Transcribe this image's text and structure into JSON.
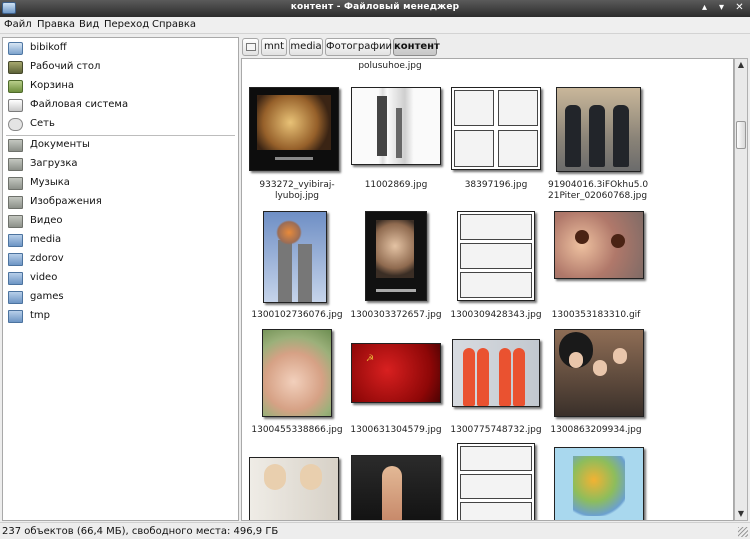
{
  "window": {
    "title": "контент - Файловый менеджер"
  },
  "menubar": {
    "items": [
      "Файл",
      "Правка",
      "Вид",
      "Переход",
      "Справка"
    ]
  },
  "sidebar": {
    "places": [
      {
        "label": "bibikoff",
        "icon": "home-folder-icon"
      },
      {
        "label": "Рабочий стол",
        "icon": "desktop-icon"
      },
      {
        "label": "Корзина",
        "icon": "trash-icon"
      },
      {
        "label": "Файловая система",
        "icon": "drive-icon"
      },
      {
        "label": "Сеть",
        "icon": "network-icon"
      }
    ],
    "bookmarks": [
      {
        "label": "Документы",
        "icon": "folder-icon"
      },
      {
        "label": "Загрузка",
        "icon": "folder-icon"
      },
      {
        "label": "Музыка",
        "icon": "folder-icon"
      },
      {
        "label": "Изображения",
        "icon": "folder-icon"
      },
      {
        "label": "Видео",
        "icon": "folder-icon"
      },
      {
        "label": "media",
        "icon": "folder-icon"
      },
      {
        "label": "zdorov",
        "icon": "folder-icon"
      },
      {
        "label": "video",
        "icon": "folder-icon"
      },
      {
        "label": "games",
        "icon": "folder-icon"
      },
      {
        "label": "tmp",
        "icon": "folder-icon"
      }
    ]
  },
  "pathbar": {
    "crumbs": [
      "mnt",
      "media",
      "Фотографии",
      "контент"
    ],
    "active": "контент"
  },
  "content": {
    "partial_label": "polusuhoe.jpg",
    "files": [
      {
        "name1": "933272_vyibiraj-",
        "name2": "lyuboj.jpg"
      },
      {
        "name1": "11002869.jpg",
        "name2": ""
      },
      {
        "name1": "38397196.jpg",
        "name2": ""
      },
      {
        "name1": "91904016.3iFOkhu5.0",
        "name2": "21Piter_02060768.jpg"
      },
      {
        "name1": "1300102736076.jpg",
        "name2": ""
      },
      {
        "name1": "1300303372657.jpg",
        "name2": ""
      },
      {
        "name1": "1300309428343.jpg",
        "name2": ""
      },
      {
        "name1": "1300353183310.gif",
        "name2": ""
      },
      {
        "name1": "1300455338866.jpg",
        "name2": ""
      },
      {
        "name1": "1300631304579.jpg",
        "name2": ""
      },
      {
        "name1": "1300775748732.jpg",
        "name2": ""
      },
      {
        "name1": "1300863209934.jpg",
        "name2": ""
      },
      {
        "name1": "",
        "name2": ""
      },
      {
        "name1": "",
        "name2": ""
      },
      {
        "name1": "",
        "name2": ""
      },
      {
        "name1": "",
        "name2": ""
      }
    ]
  },
  "statusbar": {
    "text": "237 объектов (66,4 МБ), свободного места: 496,9 ГБ"
  }
}
